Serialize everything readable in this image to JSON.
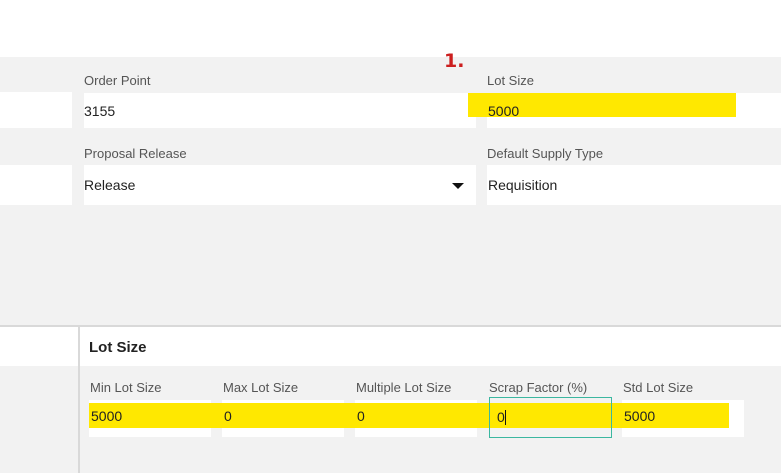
{
  "annotation": "1.",
  "planning": {
    "order_point_label": "Order Point",
    "order_point_value": "3155",
    "lot_size_label": "Lot Size",
    "lot_size_value": "5000",
    "proposal_release_label": "Proposal Release",
    "proposal_release_value": "Release",
    "default_supply_type_label": "Default Supply Type",
    "default_supply_type_value": "Requisition"
  },
  "lot_size_section": {
    "title": "Lot Size",
    "fields": [
      {
        "label": "Min Lot Size",
        "value": "5000"
      },
      {
        "label": "Max Lot Size",
        "value": "0"
      },
      {
        "label": "Multiple Lot Size",
        "value": "0"
      },
      {
        "label": "Scrap Factor (%)",
        "value": "0"
      },
      {
        "label": "Std Lot Size",
        "value": "5000"
      }
    ]
  },
  "colors": {
    "highlight": "#ffe800",
    "annotation": "#cc1f1f",
    "focus_border": "#3bb7a0",
    "panel_gray": "#f2f2f2"
  }
}
